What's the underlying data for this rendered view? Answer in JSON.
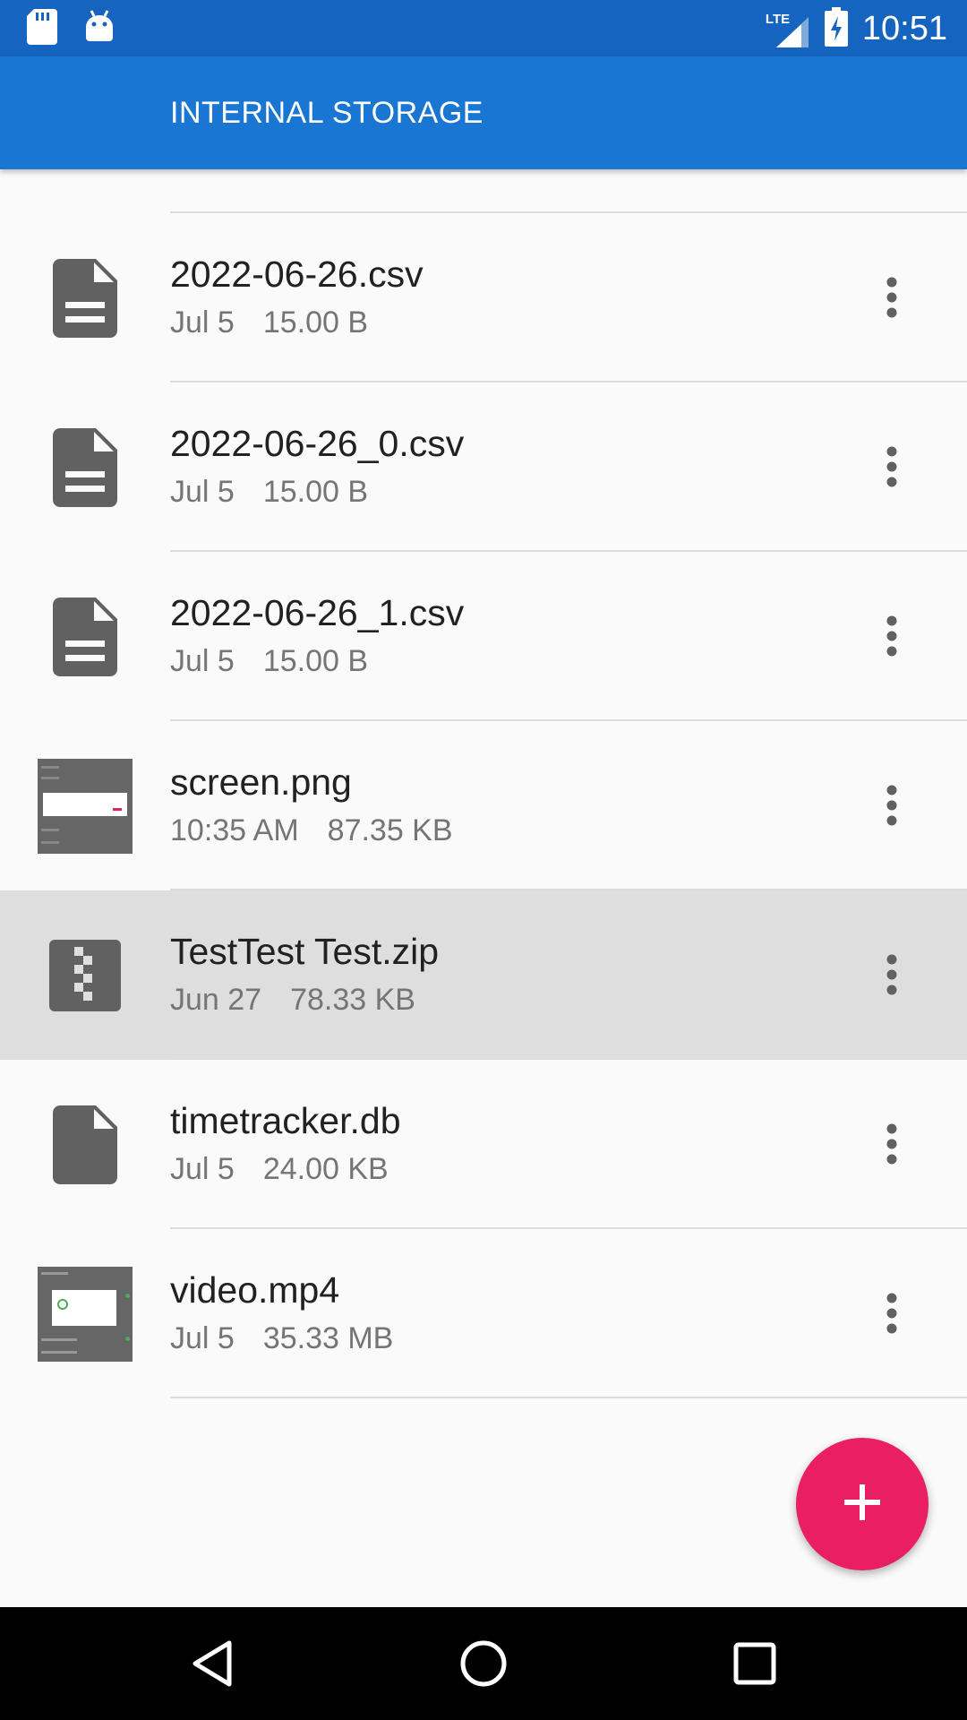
{
  "status_bar": {
    "time": "10:51",
    "network_label": "LTE",
    "left_icons": [
      "sd-card-icon",
      "android-icon"
    ],
    "right_icons": [
      "lte-signal-icon",
      "battery-charging-icon"
    ]
  },
  "app_bar": {
    "title": "INTERNAL STORAGE"
  },
  "files": [
    {
      "name": "2022-06-26.csv",
      "date": "Jul 5",
      "size": "15.00 B",
      "icon": "document-icon"
    },
    {
      "name": "2022-06-26_0.csv",
      "date": "Jul 5",
      "size": "15.00 B",
      "icon": "document-icon"
    },
    {
      "name": "2022-06-26_1.csv",
      "date": "Jul 5",
      "size": "15.00 B",
      "icon": "document-icon"
    },
    {
      "name": "screen.png",
      "date": "10:35 AM",
      "size": "87.35 KB",
      "icon": "image-thumbnail"
    },
    {
      "name": "TestTest Test.zip",
      "date": "Jun 27",
      "size": "78.33 KB",
      "icon": "zip-icon",
      "selected": true
    },
    {
      "name": "timetracker.db",
      "date": "Jul 5",
      "size": "24.00 KB",
      "icon": "file-icon"
    },
    {
      "name": "video.mp4",
      "date": "Jul 5",
      "size": "35.33 MB",
      "icon": "video-thumbnail"
    }
  ],
  "fab": {
    "icon": "plus-icon",
    "color": "#e91e63"
  },
  "nav_bar": {
    "icons": [
      "back-icon",
      "home-icon",
      "recents-icon"
    ]
  },
  "colors": {
    "status_bar": "#1565c0",
    "app_bar": "#1976d2",
    "selected_row": "#dedede",
    "icon_gray": "#616161"
  }
}
